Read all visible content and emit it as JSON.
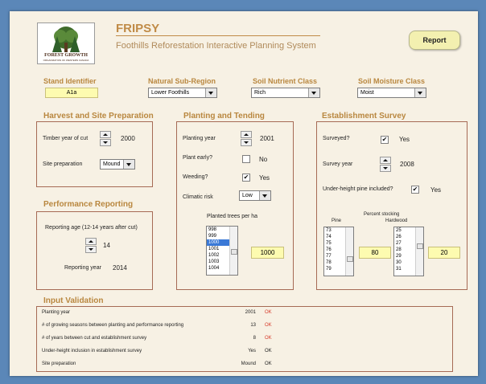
{
  "header": {
    "logo_text": "FOREST GROWTH",
    "logo_sub": "ORGANIZATION OF WESTERN CANADA",
    "title": "FRIPSY",
    "subtitle": "Foothills Reforestation Interactive Planning System",
    "report_label": "Report"
  },
  "stand": {
    "stand_identifier_label": "Stand Identifier",
    "stand_identifier_value": "A1a",
    "subregion_label": "Natural Sub-Region",
    "subregion_value": "Lower Foothills",
    "nutrient_label": "Soil Nutrient Class",
    "nutrient_value": "Rich",
    "moisture_label": "Soil Moisture Class",
    "moisture_value": "Moist"
  },
  "harvest": {
    "title": "Harvest and Site Preparation",
    "timber_label": "Timber year of cut",
    "timber_value": "2000",
    "site_prep_label": "Site preparation",
    "site_prep_value": "Mound"
  },
  "performance": {
    "title": "Performance Reporting",
    "age_label": "Reporting age (12-14 years after cut)",
    "age_value": "14",
    "year_label": "Reporting year",
    "year_value": "2014"
  },
  "planting": {
    "title": "Planting and Tending",
    "planting_year_label": "Planting year",
    "planting_year_value": "2001",
    "plant_early_label": "Plant early?",
    "plant_early_value": "No",
    "weeding_label": "Weeding?",
    "weeding_value": "Yes",
    "climatic_label": "Climatic risk",
    "climatic_value": "Low",
    "trees_label": "Planted trees per ha",
    "trees_list": [
      "998",
      "999",
      "1000",
      "1001",
      "1002",
      "1003",
      "1004"
    ],
    "trees_selected": "1000",
    "trees_value": "1000"
  },
  "establishment": {
    "title": "Establishment Survey",
    "surveyed_label": "Surveyed?",
    "surveyed_value": "Yes",
    "survey_year_label": "Survey year",
    "survey_year_value": "2008",
    "underheight_label": "Under-height pine included?",
    "underheight_value": "Yes",
    "stocking_label": "Percent stocking",
    "pine_label": "Pine",
    "hardwood_label": "Hardwood",
    "pine_list": [
      "73",
      "74",
      "75",
      "76",
      "77",
      "78",
      "79"
    ],
    "pine_value": "80",
    "hardwood_list": [
      "25",
      "26",
      "27",
      "28",
      "29",
      "30",
      "31"
    ],
    "hardwood_value": "20"
  },
  "validation": {
    "title": "Input Validation",
    "rows": [
      {
        "label": "Planting year",
        "value": "2001",
        "status": "OK",
        "status_color": "#d63a2a"
      },
      {
        "label": "# of growing seasons between planting and performance reporting",
        "value": "13",
        "status": "OK",
        "status_color": "#d63a2a"
      },
      {
        "label": "# of years between cut and establishment survey",
        "value": "8",
        "status": "OK",
        "status_color": "#d63a2a"
      },
      {
        "label": "Under-height inclusion in establishment survey",
        "value": "Yes",
        "status": "OK",
        "status_color": "#222222"
      },
      {
        "label": "Site preparation",
        "value": "Mound",
        "status": "OK",
        "status_color": "#222222"
      }
    ]
  },
  "colors": {
    "section_title": "#b9873f",
    "panel_border": "#a66a55",
    "input_yellow": "#fdfbb0",
    "background": "#f7f1e4",
    "report_button": "#f3f0b0"
  }
}
